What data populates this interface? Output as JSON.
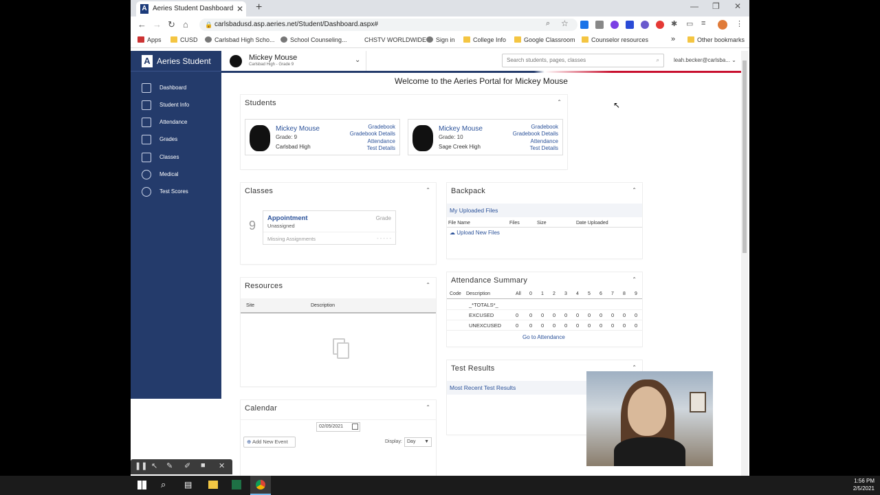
{
  "browser": {
    "tab_title": "Aeries Student Dashboard",
    "url": "carlsbadusd.asp.aeries.net/Student/Dashboard.aspx#",
    "bookmarks": [
      "Apps",
      "CUSD",
      "Carlsbad High Scho...",
      "School Counseling...",
      "CHSTV WORLDWIDE",
      "Sign in",
      "College Info",
      "Google Classroom",
      "Counselor resources"
    ],
    "other_bookmarks": "Other bookmarks",
    "more": "»"
  },
  "app": {
    "logo": "Aeries Student",
    "logo_letter": "A",
    "nav": [
      "Dashboard",
      "Student Info",
      "Attendance",
      "Grades",
      "Classes",
      "Medical",
      "Test Scores"
    ],
    "current_student": {
      "name": "Mickey Mouse",
      "sub": "Carlsbad High - Grade 9"
    },
    "search_placeholder": "Search students, pages, classes",
    "user": "leah.becker@carlsba...",
    "welcome": "Welcome to the Aeries Portal for Mickey Mouse"
  },
  "students": {
    "title": "Students",
    "list": [
      {
        "name": "Mickey Mouse",
        "grade": "Grade: 9",
        "school": "Carlsbad High",
        "links": [
          "Gradebook",
          "Gradebook Details",
          "Attendance",
          "Test Details"
        ]
      },
      {
        "name": "Mickey Mouse",
        "grade": "Grade: 10",
        "school": "Sage Creek High",
        "links": [
          "Gradebook",
          "Gradebook Details",
          "Attendance",
          "Test Details"
        ]
      }
    ]
  },
  "classes": {
    "title": "Classes",
    "period": "9",
    "item": {
      "name": "Appointment",
      "teacher": "Unassigned",
      "grade_label": "Grade",
      "missing": "Missing Assignments",
      "dashes": "-  -  -  -  -"
    }
  },
  "backpack": {
    "title": "Backpack",
    "sub": "My Uploaded Files",
    "cols": [
      "File Name",
      "Files",
      "Size",
      "Date Uploaded"
    ],
    "upload": "Upload New Files"
  },
  "resources": {
    "title": "Resources",
    "cols": [
      "Site",
      "Description"
    ]
  },
  "attendance": {
    "title": "Attendance Summary",
    "cols": [
      "Code",
      "Description",
      "All",
      "0",
      "1",
      "2",
      "3",
      "4",
      "5",
      "6",
      "7",
      "8",
      "9"
    ],
    "rows": [
      {
        "desc": "_*TOTALS*_",
        "vals": []
      },
      {
        "desc": "EXCUSED",
        "vals": [
          "0",
          "0",
          "0",
          "0",
          "0",
          "0",
          "0",
          "0",
          "0",
          "0",
          "0"
        ]
      },
      {
        "desc": "UNEXCUSED",
        "vals": [
          "0",
          "0",
          "0",
          "0",
          "0",
          "0",
          "0",
          "0",
          "0",
          "0",
          "0"
        ]
      }
    ],
    "link": "Go to Attendance"
  },
  "test_results": {
    "title": "Test Results",
    "sub": "Most Recent Test Results"
  },
  "calendar": {
    "title": "Calendar",
    "date": "02/05/2021",
    "add": "Add New Event",
    "display_label": "Display:",
    "display_value": "Day"
  },
  "taskbar": {
    "time": "1:56 PM",
    "date": "2/5/2021"
  },
  "colors": {
    "sidebar": "#243b6b",
    "accent_red": "#c8102e",
    "link": "#2a5199"
  }
}
